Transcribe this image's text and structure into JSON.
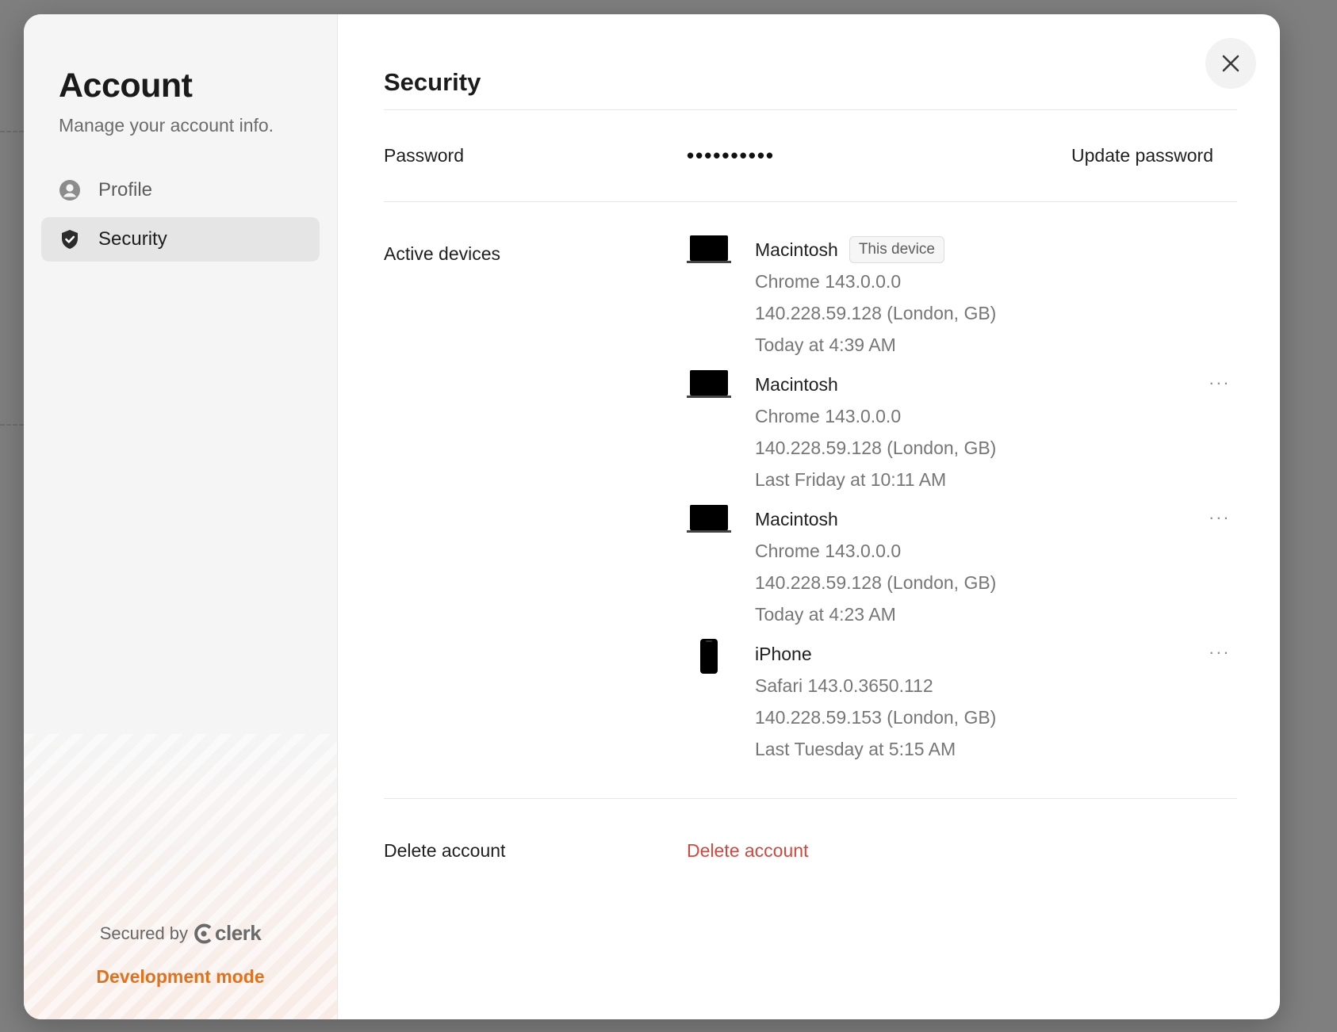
{
  "sidebar": {
    "title": "Account",
    "subtitle": "Manage your account info.",
    "items": [
      {
        "label": "Profile",
        "icon": "user-circle-icon",
        "active": false
      },
      {
        "label": "Security",
        "icon": "shield-check-icon",
        "active": true
      }
    ],
    "footer": {
      "secured_by": "Secured by",
      "brand": "clerk",
      "mode": "Development mode"
    }
  },
  "main": {
    "title": "Security",
    "password": {
      "label": "Password",
      "masked": "••••••••••",
      "action": "Update password"
    },
    "devices": {
      "label": "Active devices",
      "items": [
        {
          "name": "Macintosh",
          "badge": "This device",
          "browser": "Chrome 143.0.0.0",
          "ip": "140.228.59.128 (London, GB)",
          "time": "Today at 4:39 AM",
          "type": "laptop"
        },
        {
          "name": "Macintosh",
          "browser": "Chrome 143.0.0.0",
          "ip": "140.228.59.128 (London, GB)",
          "time": "Last Friday at 10:11 AM",
          "type": "laptop",
          "more": "..."
        },
        {
          "name": "Macintosh",
          "browser": "Chrome 143.0.0.0",
          "ip": "140.228.59.128 (London, GB)",
          "time": "Today at 4:23 AM",
          "type": "laptop",
          "more": "..."
        },
        {
          "name": "iPhone",
          "browser": "Safari 143.0.3650.112",
          "ip": "140.228.59.153 (London, GB)",
          "time": "Last Tuesday at 5:15 AM",
          "type": "phone",
          "more": "..."
        }
      ]
    },
    "delete": {
      "label": "Delete account",
      "action": "Delete account"
    }
  },
  "colors": {
    "danger": "#d8453c",
    "dev_mode": "#e0711f",
    "backdrop": "#7f7f7f"
  }
}
